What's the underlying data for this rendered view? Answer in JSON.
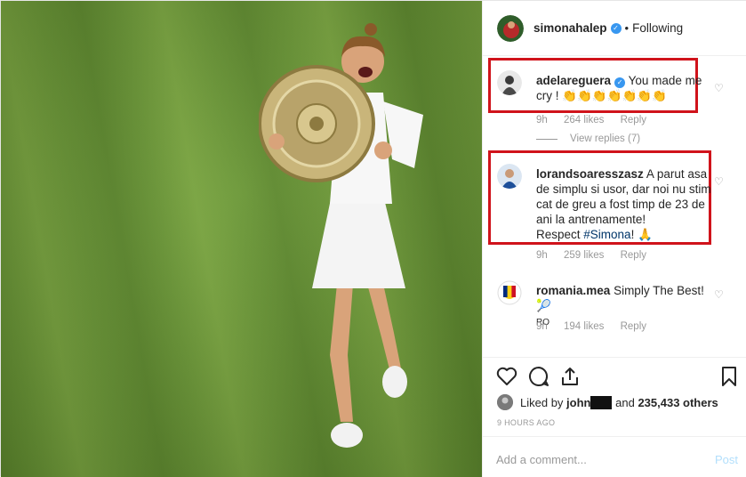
{
  "header": {
    "username": "simonahalep",
    "separator": "•",
    "follow_status": "Following"
  },
  "comments": [
    {
      "username": "adelareguera",
      "text": "You made me cry ! 👏👏👏👏👏👏👏",
      "time": "9h",
      "likes": "264 likes",
      "reply": "Reply",
      "view_replies": "View replies (7)",
      "verified": true
    },
    {
      "username": "lorandsoaresszasz",
      "text": "A parut asa de simplu si usor, dar noi nu stim cat de greu a fost timp de 23 de ani la antrenamente!",
      "text2_prefix": "Respect ",
      "hashtag": "#Simona",
      "text2_suffix": "! 🙏",
      "time": "9h",
      "likes": "259 likes",
      "reply": "Reply"
    },
    {
      "username": "romania.mea",
      "text": "Simply The Best!🎾",
      "sub": "RO",
      "time": "9h",
      "likes": "194 likes",
      "reply": "Reply"
    }
  ],
  "likes": {
    "prefix": "Liked by",
    "user": "john",
    "connector": "and",
    "count": "235,433 others"
  },
  "timestamp": "9 HOURS AGO",
  "add_comment": {
    "placeholder": "Add a comment...",
    "post_label": "Post"
  },
  "colors": {
    "highlight": "#d0131b",
    "link": "#003569",
    "verified": "#3897f0",
    "muted": "#999999"
  },
  "icons": [
    "heart-icon",
    "comment-icon",
    "share-icon",
    "bookmark-icon",
    "verified-badge-icon"
  ]
}
